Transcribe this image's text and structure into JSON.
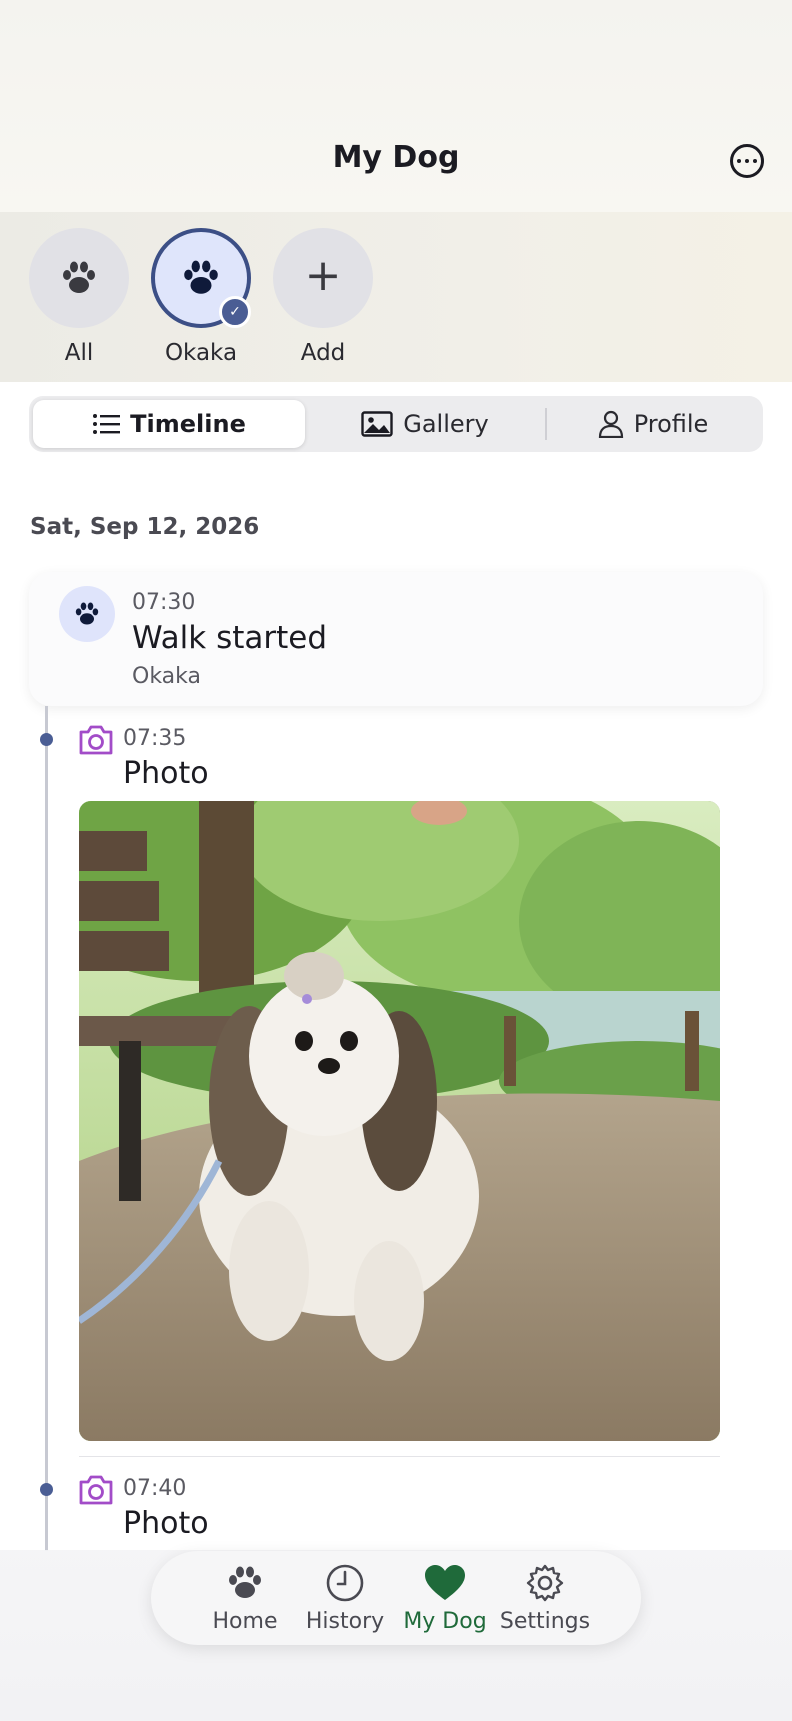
{
  "header": {
    "title": "My Dog",
    "more_icon": "ellipsis-circle-icon"
  },
  "dogs": [
    {
      "label": "All",
      "icon": "paw-icon",
      "selected": false
    },
    {
      "label": "Okaka",
      "icon": "paw-icon",
      "selected": true,
      "badge": "checkmark-icon"
    },
    {
      "label": "Add",
      "icon": "plus-icon",
      "selected": false
    }
  ],
  "segments": [
    {
      "label": "Timeline",
      "icon": "list-icon",
      "active": true
    },
    {
      "label": "Gallery",
      "icon": "photo-icon",
      "active": false
    },
    {
      "label": "Profile",
      "icon": "person-icon",
      "active": false
    }
  ],
  "timeline": {
    "date": "Sat, Sep 12, 2026",
    "walk_event": {
      "time": "07:30",
      "title": "Walk started",
      "subtitle": "Okaka",
      "icon": "paw-icon"
    },
    "photo_events": [
      {
        "time": "07:35",
        "title": "Photo",
        "icon": "camera-icon"
      },
      {
        "time": "07:40",
        "title": "Photo",
        "icon": "camera-icon"
      }
    ]
  },
  "tabbar": [
    {
      "label": "Home",
      "icon": "paw-icon",
      "active": false
    },
    {
      "label": "History",
      "icon": "clock-icon",
      "active": false
    },
    {
      "label": "My Dog",
      "icon": "heart-icon",
      "active": true
    },
    {
      "label": "Settings",
      "icon": "gear-icon",
      "active": false
    }
  ],
  "colors": {
    "accent": "#4a5d94",
    "tab_active": "#1f6a3a",
    "camera_icon": "#a24cc8"
  }
}
